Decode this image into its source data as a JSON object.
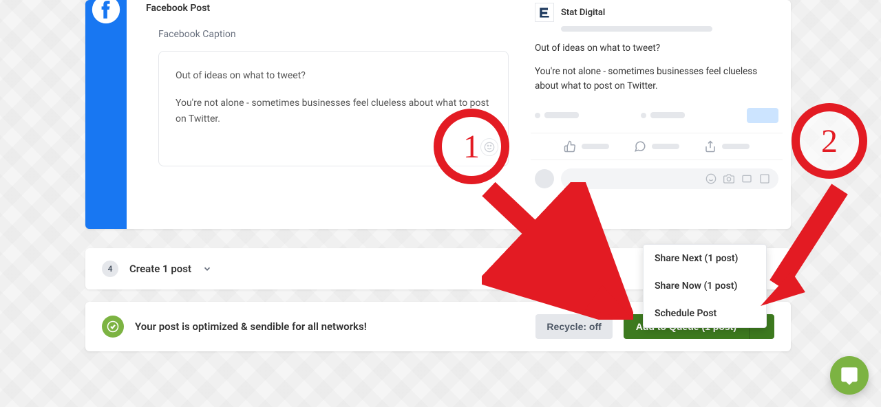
{
  "compose": {
    "section_title": "Facebook Post",
    "caption_label": "Facebook Caption",
    "caption_line1": "Out of ideas on what to tweet?",
    "caption_line2": "You're not alone - sometimes businesses feel clueless about what to post on Twitter."
  },
  "preview": {
    "account_name": "Stat Digital",
    "body_line1": "Out of ideas on what to tweet?",
    "body_line2": "You're not alone - sometimes businesses feel clueless about what to post on Twitter."
  },
  "step": {
    "number": "4",
    "label": "Create 1 post"
  },
  "footer": {
    "status_text": "Your post is optimized & sendible for all networks!",
    "recycle_label": "Recycle: off",
    "queue_label": "Add to Queue (1 post)"
  },
  "dropdown": {
    "items": [
      "Share Next (1 post)",
      "Share Now (1 post)",
      "Schedule Post"
    ]
  },
  "annotations": {
    "one": "1",
    "two": "2"
  }
}
